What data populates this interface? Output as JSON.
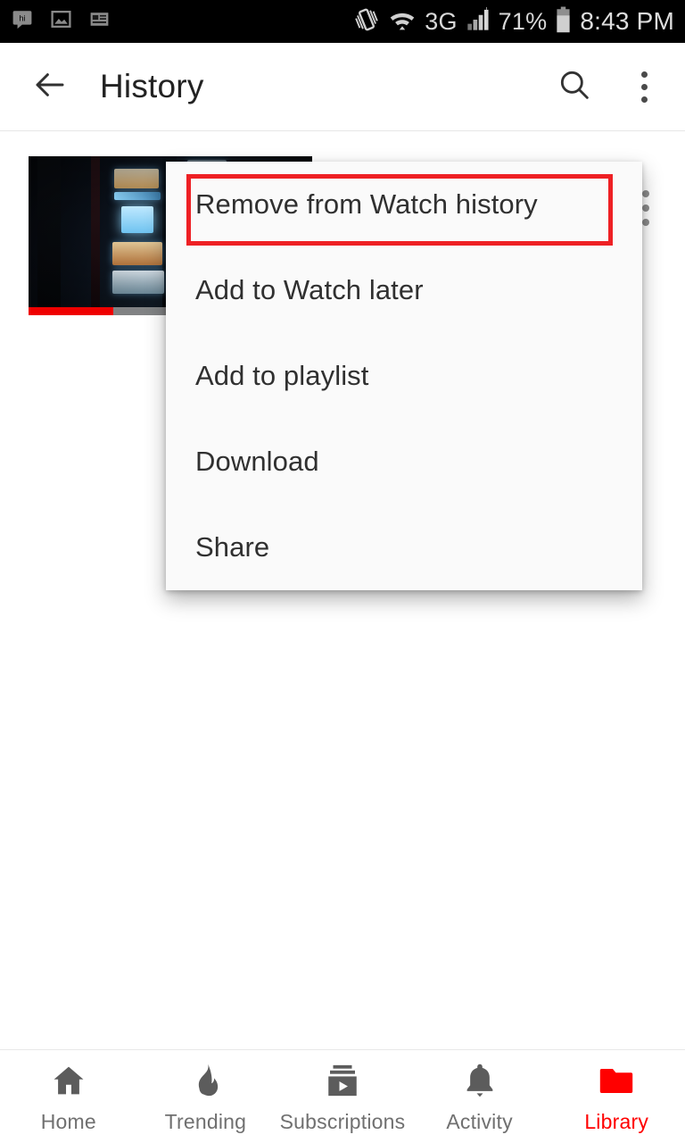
{
  "status_bar": {
    "left_icons": [
      {
        "name": "hike-messenger-icon",
        "label": "hi"
      },
      {
        "name": "image-icon",
        "label": "image"
      },
      {
        "name": "news-card-icon",
        "label": "news"
      }
    ],
    "right_icons": [
      {
        "name": "vibrate-icon",
        "label": "vibrate"
      },
      {
        "name": "wifi-icon",
        "label": "wifi"
      },
      {
        "name": "signal-bars-icon",
        "label": "signal"
      },
      {
        "name": "battery-icon",
        "label": "battery"
      }
    ],
    "network_type": "3G",
    "battery_percent": "71%",
    "time": "8:43 PM"
  },
  "app_bar": {
    "back_icon": "arrow-back-icon",
    "title": "History",
    "search_icon": "search-icon",
    "overflow_icon": "more-vertical-icon"
  },
  "video_row": {
    "overflow_icon": "more-vertical-icon",
    "progress_percent": 30
  },
  "popup_menu": {
    "items": [
      {
        "label": "Remove from Watch history",
        "highlighted": true
      },
      {
        "label": "Add to Watch later",
        "highlighted": false
      },
      {
        "label": "Add to playlist",
        "highlighted": false
      },
      {
        "label": "Download",
        "highlighted": false
      },
      {
        "label": "Share",
        "highlighted": false
      }
    ],
    "highlight_color": "#ee2024"
  },
  "bottom_nav": {
    "active_color": "#ff0000",
    "inactive_color": "#707070",
    "items": [
      {
        "label": "Home",
        "icon": "home-icon",
        "active": false
      },
      {
        "label": "Trending",
        "icon": "flame-icon",
        "active": false
      },
      {
        "label": "Subscriptions",
        "icon": "subscriptions-icon",
        "active": false
      },
      {
        "label": "Activity",
        "icon": "bell-icon",
        "active": false
      },
      {
        "label": "Library",
        "icon": "folder-icon",
        "active": true
      }
    ]
  }
}
